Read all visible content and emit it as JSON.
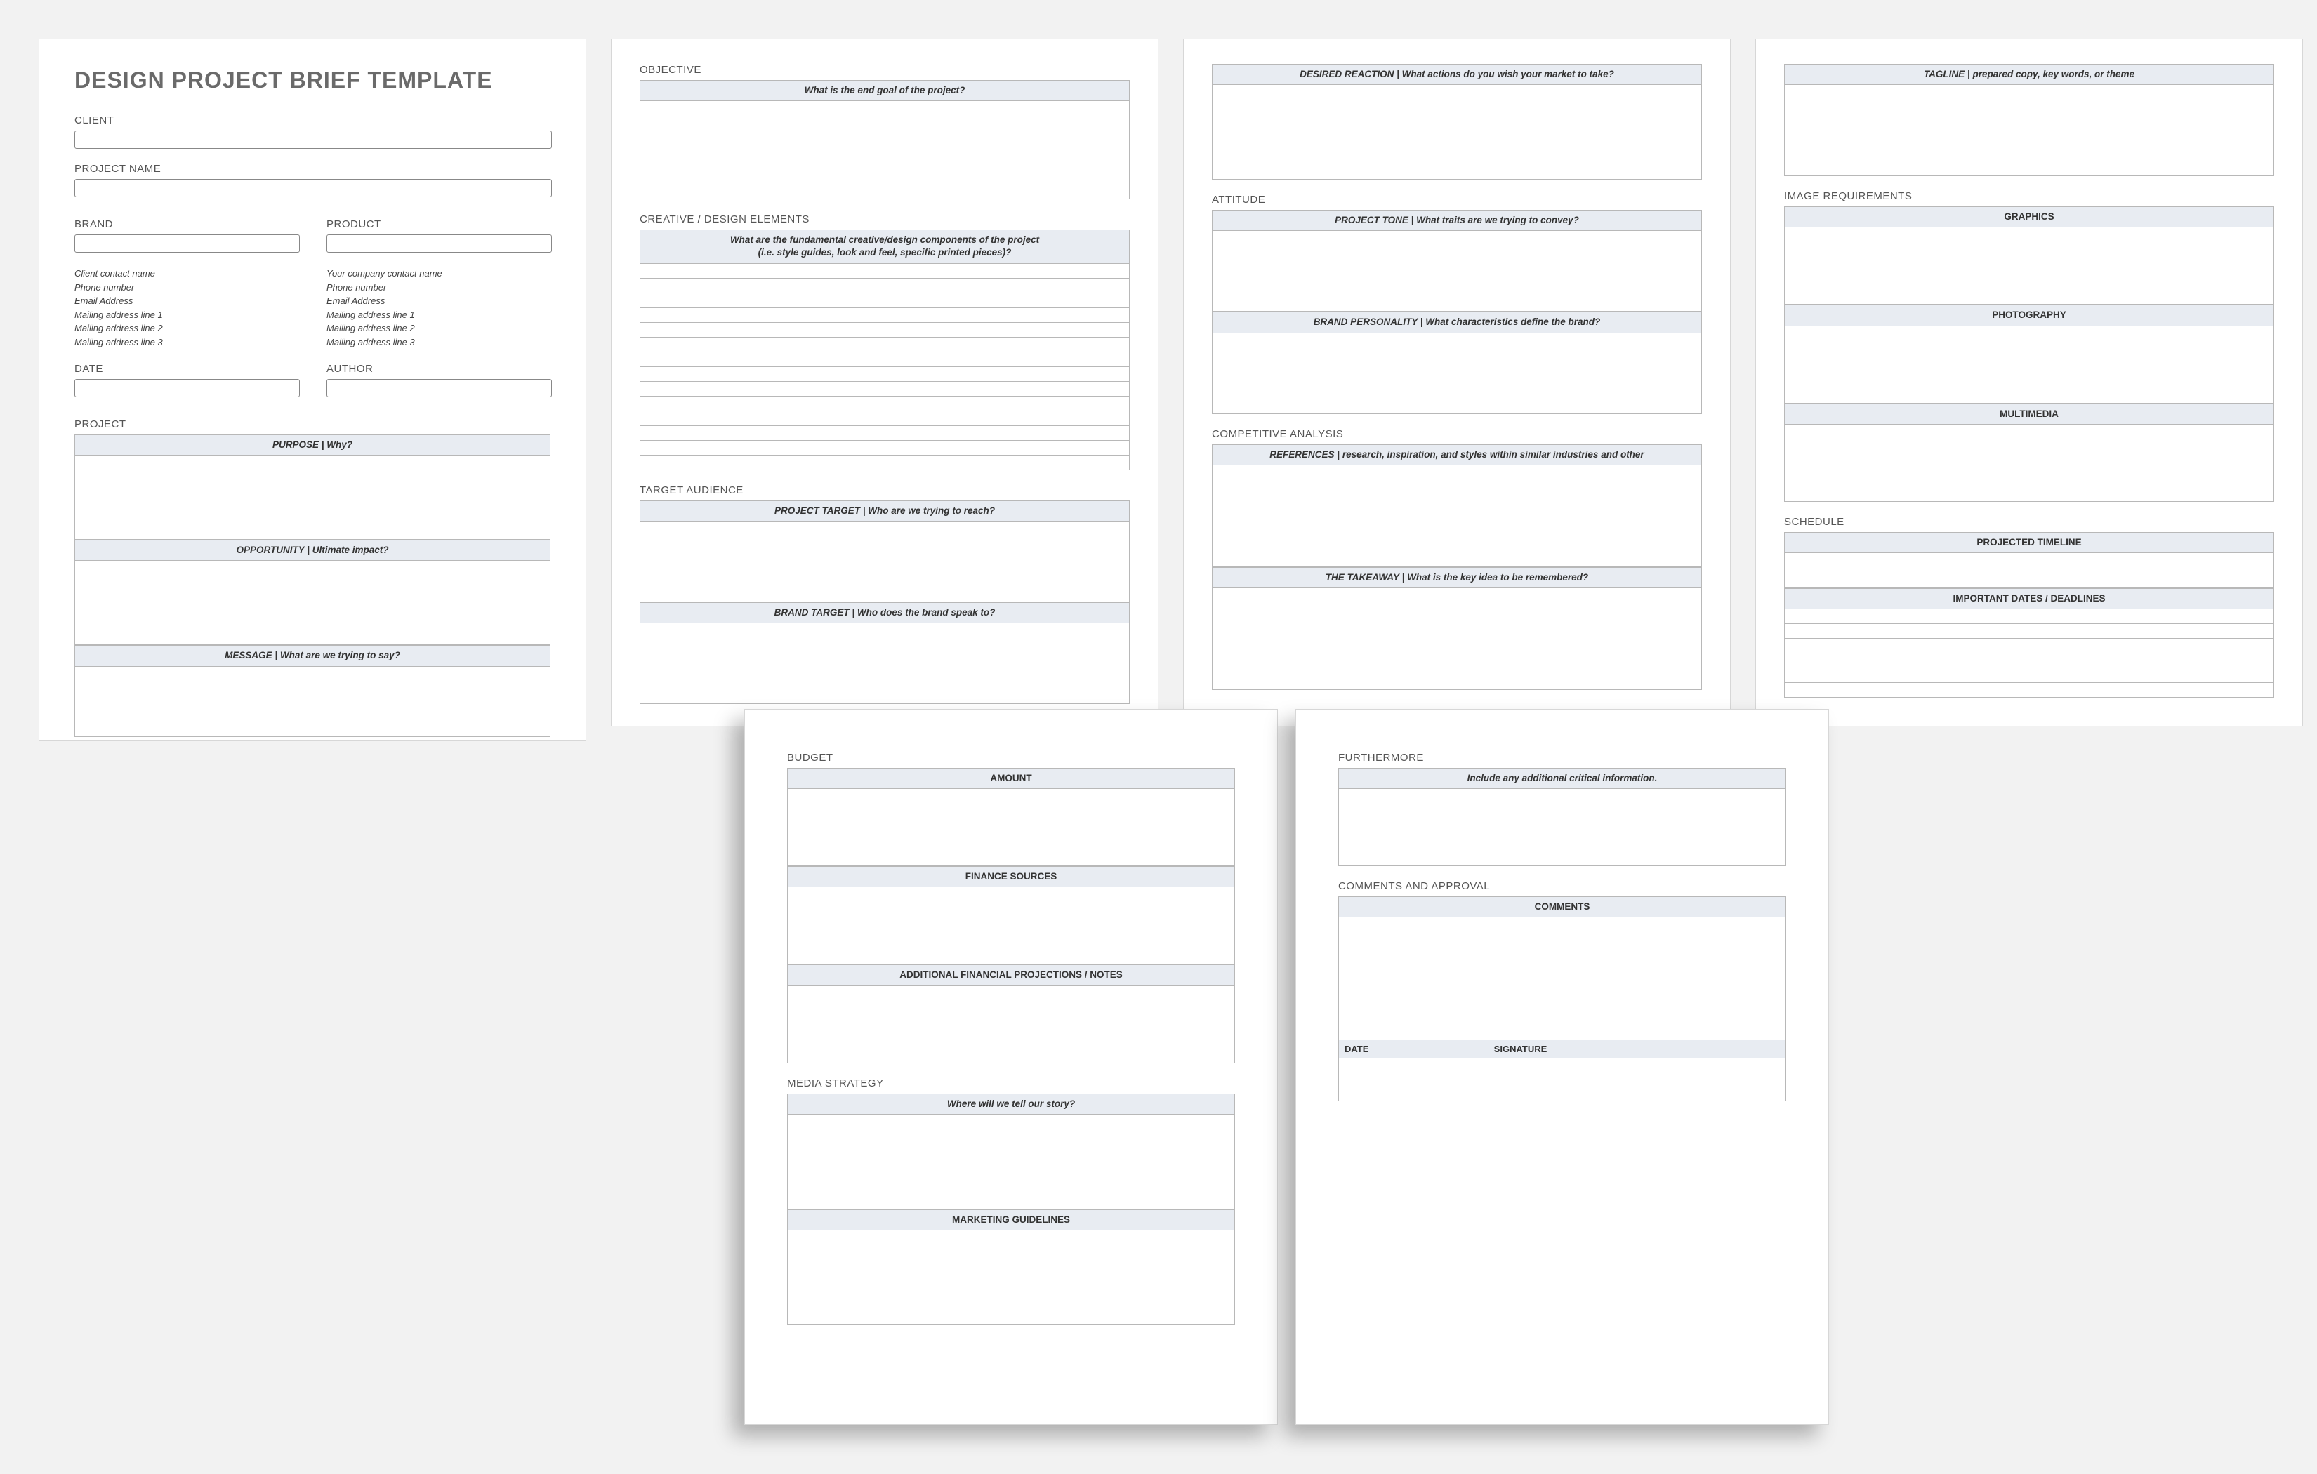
{
  "doc_title": "DESIGN PROJECT BRIEF TEMPLATE",
  "page1": {
    "client_label": "CLIENT",
    "project_name_label": "PROJECT NAME",
    "brand_label": "BRAND",
    "product_label": "PRODUCT",
    "client_contact": [
      "Client contact name",
      "Phone number",
      "Email Address",
      "Mailing address line 1",
      "Mailing address line 2",
      "Mailing address line 3"
    ],
    "company_contact": [
      "Your company contact name",
      "Phone number",
      "Email Address",
      "Mailing address line 1",
      "Mailing address line 2",
      "Mailing address line 3"
    ],
    "date_label": "DATE",
    "author_label": "AUTHOR",
    "project_label": "PROJECT",
    "purpose_hdr": "PURPOSE  |  Why?",
    "opportunity_hdr": "OPPORTUNITY  |  Ultimate impact?",
    "message_hdr": "MESSAGE  |  What are we trying to say?"
  },
  "page2": {
    "objective_label": "OBJECTIVE",
    "objective_hdr": "What is the end goal of the project?",
    "creative_label": "CREATIVE / DESIGN ELEMENTS",
    "creative_hdr_l1": "What are the fundamental creative/design components of the project",
    "creative_hdr_l2": "(i.e. style guides, look and feel, specific printed pieces)?",
    "target_label": "TARGET AUDIENCE",
    "project_target_hdr": "PROJECT TARGET  |  Who are we trying to reach?",
    "brand_target_hdr": "BRAND TARGET  |  Who does the brand speak to?"
  },
  "page3": {
    "desired_reaction_hdr": "DESIRED REACTION  |  What actions do you wish your market to take?",
    "attitude_label": "ATTITUDE",
    "project_tone_hdr": "PROJECT TONE  |  What traits are we trying to convey?",
    "brand_personality_hdr": "BRAND PERSONALITY  |  What characteristics define the brand?",
    "competitive_label": "COMPETITIVE ANALYSIS",
    "references_hdr": "REFERENCES  |  research, inspiration, and styles within similar industries and other",
    "takeaway_hdr": "THE TAKEAWAY  |  What is the key idea to be remembered?"
  },
  "page4": {
    "tagline_hdr": "TAGLINE  |  prepared copy, key words, or theme",
    "image_req_label": "IMAGE REQUIREMENTS",
    "graphics_hdr": "GRAPHICS",
    "photography_hdr": "PHOTOGRAPHY",
    "multimedia_hdr": "MULTIMEDIA",
    "schedule_label": "SCHEDULE",
    "timeline_hdr": "PROJECTED TIMELINE",
    "dates_hdr": "IMPORTANT DATES / DEADLINES"
  },
  "page5": {
    "budget_label": "BUDGET",
    "amount_hdr": "AMOUNT",
    "finance_sources_hdr": "FINANCE SOURCES",
    "additional_fin_hdr": "ADDITIONAL FINANCIAL PROJECTIONS / NOTES",
    "media_label": "MEDIA STRATEGY",
    "media_story_hdr": "Where will we tell our story?",
    "marketing_hdr": "MARKETING GUIDELINES"
  },
  "page6": {
    "furthermore_label": "FURTHERMORE",
    "furthermore_hdr": "Include any additional critical information.",
    "comments_label": "COMMENTS AND APPROVAL",
    "comments_hdr": "COMMENTS",
    "date_label": "DATE",
    "signature_label": "SIGNATURE"
  }
}
